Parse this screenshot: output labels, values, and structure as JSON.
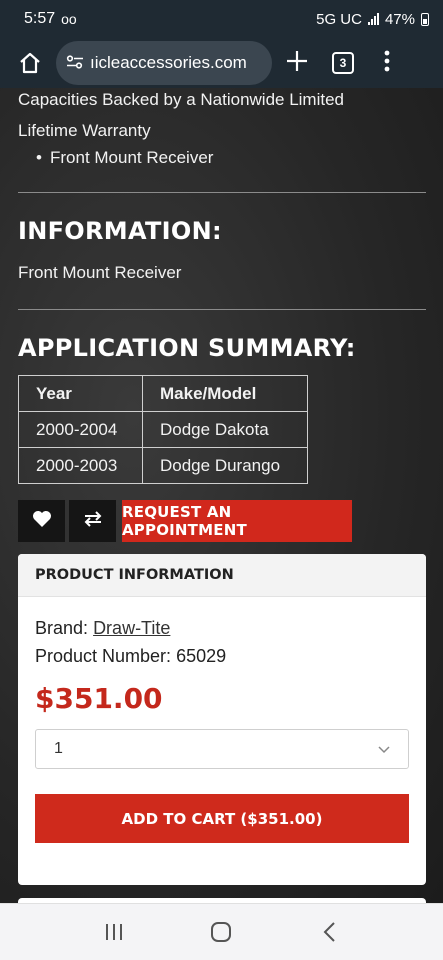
{
  "status_bar": {
    "time": "5:57",
    "left_glyph": "oo",
    "network": "5G UC",
    "battery": "47%"
  },
  "browser": {
    "url": "ıicleaccessories.com",
    "tab_count": "3"
  },
  "content": {
    "cut_line": "Capacities Backed by a Nationwide Limited",
    "warranty_line": "Lifetime Warranty",
    "bullet": "Front Mount Receiver",
    "info_heading": "INFORMATION:",
    "info_text": "Front Mount Receiver",
    "summary_heading": "APPLICATION SUMMARY:",
    "table": {
      "headers": [
        "Year",
        "Make/Model"
      ],
      "rows": [
        [
          "2000-2004",
          "Dodge Dakota"
        ],
        [
          "2000-2003",
          "Dodge Durango"
        ]
      ]
    },
    "appointment_label": "REQUEST AN APPOINTMENT"
  },
  "product": {
    "header": "PRODUCT INFORMATION",
    "brand_label": "Brand:",
    "brand_value": "Draw-Tite",
    "number_label": "Product Number:",
    "number_value": "65029",
    "price": "$351.00",
    "quantity": "1",
    "add_to_cart": "ADD TO CART ($351.00)"
  },
  "icons": {
    "home": "home-icon",
    "tune": "site-settings-icon",
    "plus": "new-tab-icon",
    "more": "more-vert-icon",
    "heart": "heart-icon",
    "compare": "compare-icon"
  }
}
